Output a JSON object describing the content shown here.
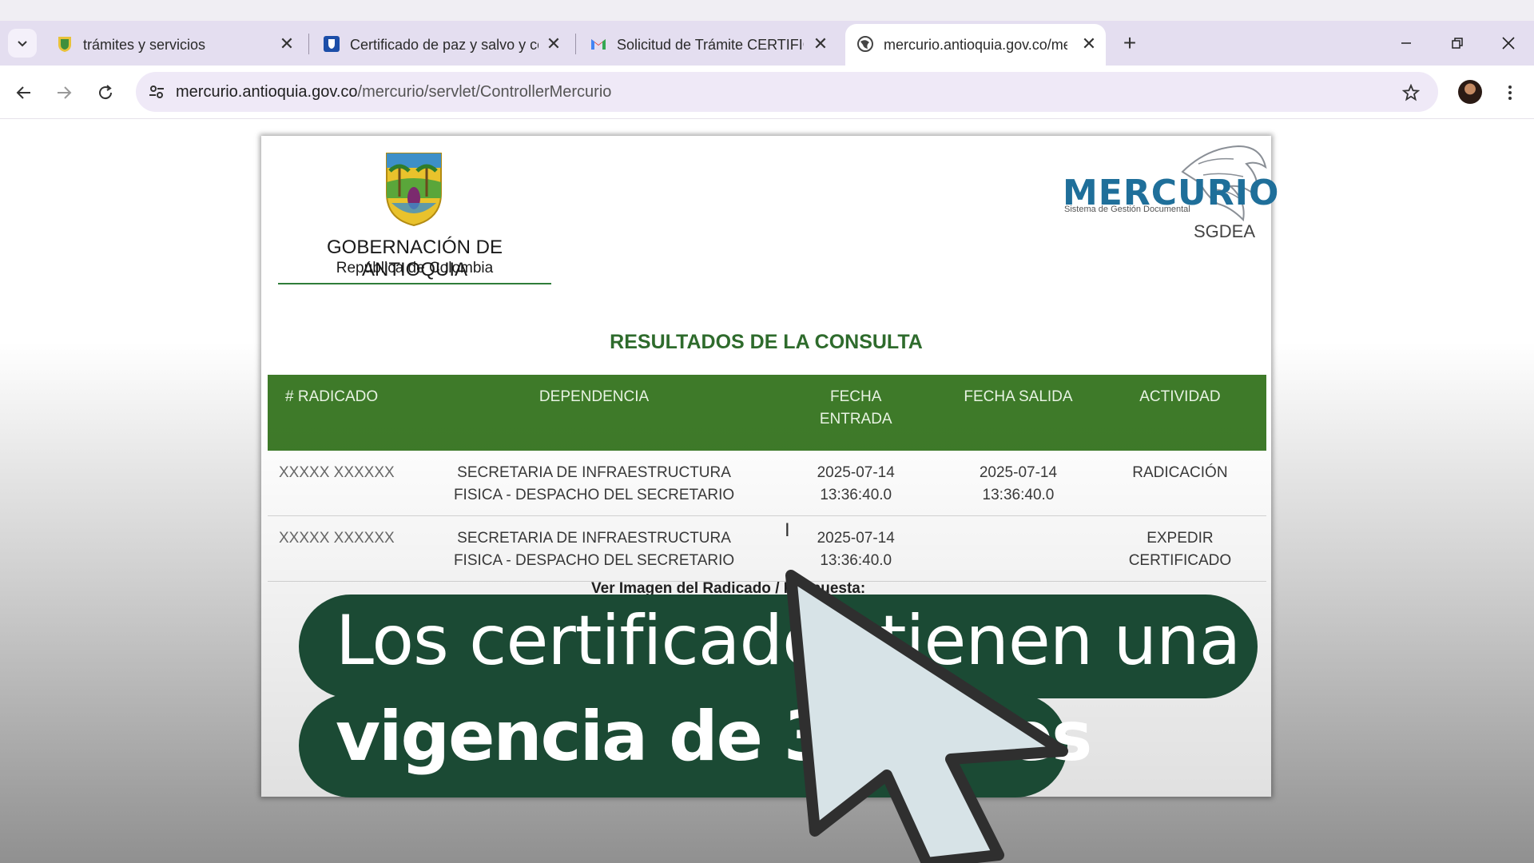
{
  "browser": {
    "tabs": [
      {
        "title": "trámites y servicios",
        "favicon": "shield-crest-icon",
        "active": false
      },
      {
        "title": "Certificado de paz y salvo y cert",
        "favicon": "shield-blue-icon",
        "active": false
      },
      {
        "title": "Solicitud de Trámite CERTIFICAD",
        "favicon": "gmail-icon",
        "active": false
      },
      {
        "title": "mercurio.antioquia.gov.co/merc",
        "favicon": "globe-icon",
        "active": true
      }
    ],
    "url_host": "mercurio.antioquia.gov.co",
    "url_path": "/mercurio/servlet/ControllerMercurio"
  },
  "page": {
    "gov_name": "GOBERNACIÓN DE ANTIOQUIA",
    "gov_sub": "República de Colombia",
    "system_logo": "MERCURIO",
    "system_tagline": "Sistema de Gestión Documental",
    "system_sub": "SGDEA",
    "results_title": "RESULTADOS DE LA CONSULTA",
    "table": {
      "headers": [
        "# RADICADO",
        "DEPENDENCIA",
        "FECHA ENTRADA",
        "FECHA SALIDA",
        "ACTIVIDAD"
      ],
      "rows": [
        {
          "radicado": "XXXXX XXXXXX",
          "dependencia": "SECRETARIA DE INFRAESTRUCTURA FISICA - DESPACHO DEL SECRETARIO",
          "entrada": "2025-07-14 13:36:40.0",
          "salida": "2025-07-14 13:36:40.0",
          "actividad": "RADICACIÓN"
        },
        {
          "radicado": "XXXXX XXXXXX",
          "dependencia": "SECRETARIA DE INFRAESTRUCTURA FISICA - DESPACHO DEL SECRETARIO",
          "entrada": "2025-07-14 13:36:40.0",
          "salida": "",
          "actividad": "EXPEDIR CERTIFICADO"
        }
      ]
    },
    "ver_imagen_label": "Ver Imagen del Radicado / Respuesta:"
  },
  "caption": {
    "line1": "Los certificados tienen una",
    "line2": "vigencia de 3 meses"
  },
  "colors": {
    "header_green": "#3e7a29",
    "title_green": "#2e6b2c",
    "caption_bg": "#1b4a34",
    "logo_blue": "#1f6f9a"
  }
}
